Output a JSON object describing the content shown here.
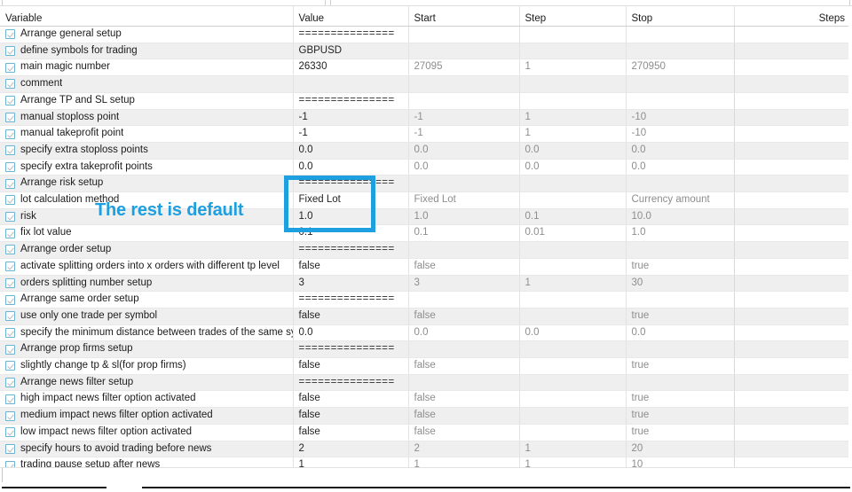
{
  "window": {
    "tabs": [
      {
        "label": ""
      },
      {
        "label": ""
      }
    ]
  },
  "table": {
    "headers": {
      "variable": "Variable",
      "value": "Value",
      "start": "Start",
      "step": "Step",
      "stop": "Stop",
      "steps": "Steps"
    },
    "rows": [
      {
        "checked": true,
        "variable": "Arrange general setup",
        "value": "===============",
        "start": "",
        "step": "",
        "stop": "",
        "steps": ""
      },
      {
        "checked": true,
        "variable": "define symbols for trading",
        "value": "GBPUSD",
        "start": "",
        "step": "",
        "stop": "",
        "steps": ""
      },
      {
        "checked": true,
        "variable": "main magic number",
        "value": "26330",
        "start": "27095",
        "step": "1",
        "stop": "270950",
        "steps": ""
      },
      {
        "checked": true,
        "variable": "comment",
        "value": "",
        "start": "",
        "step": "",
        "stop": "",
        "steps": ""
      },
      {
        "checked": true,
        "variable": "Arrange TP and SL setup",
        "value": "===============",
        "start": "",
        "step": "",
        "stop": "",
        "steps": ""
      },
      {
        "checked": true,
        "variable": "manual stoploss point",
        "value": "-1",
        "start": "-1",
        "step": "1",
        "stop": "-10",
        "steps": ""
      },
      {
        "checked": true,
        "variable": "manual takeprofit point",
        "value": "-1",
        "start": "-1",
        "step": "1",
        "stop": "-10",
        "steps": ""
      },
      {
        "checked": true,
        "variable": "specify extra stoploss points",
        "value": "0.0",
        "start": "0.0",
        "step": "0.0",
        "stop": "0.0",
        "steps": ""
      },
      {
        "checked": true,
        "variable": "specify extra takeprofit points",
        "value": "0.0",
        "start": "0.0",
        "step": "0.0",
        "stop": "0.0",
        "steps": ""
      },
      {
        "checked": true,
        "variable": "Arrange risk setup",
        "value": "===============",
        "start": "",
        "step": "",
        "stop": "",
        "steps": ""
      },
      {
        "checked": true,
        "variable": "lot calculation method",
        "value": "Fixed Lot",
        "start": "Fixed Lot",
        "step": "",
        "stop": "Currency amount",
        "steps": ""
      },
      {
        "checked": true,
        "variable": "risk",
        "value": "1.0",
        "start": "1.0",
        "step": "0.1",
        "stop": "10.0",
        "steps": ""
      },
      {
        "checked": true,
        "variable": "fix lot value",
        "value": "0.1",
        "start": "0.1",
        "step": "0.01",
        "stop": "1.0",
        "steps": ""
      },
      {
        "checked": true,
        "variable": "Arrange order setup",
        "value": "===============",
        "start": "",
        "step": "",
        "stop": "",
        "steps": ""
      },
      {
        "checked": true,
        "variable": "activate splitting orders into x orders with different tp level",
        "value": "false",
        "start": "false",
        "step": "",
        "stop": "true",
        "steps": ""
      },
      {
        "checked": true,
        "variable": "orders splitting number setup",
        "value": "3",
        "start": "3",
        "step": "1",
        "stop": "30",
        "steps": ""
      },
      {
        "checked": true,
        "variable": "Arrange same order setup",
        "value": "===============",
        "start": "",
        "step": "",
        "stop": "",
        "steps": ""
      },
      {
        "checked": true,
        "variable": "use only one trade per symbol",
        "value": "false",
        "start": "false",
        "step": "",
        "stop": "true",
        "steps": ""
      },
      {
        "checked": true,
        "variable": "specify the minimum distance between trades of the same sym...",
        "value": "0.0",
        "start": "0.0",
        "step": "0.0",
        "stop": "0.0",
        "steps": ""
      },
      {
        "checked": true,
        "variable": "Arrange prop firms setup",
        "value": "===============",
        "start": "",
        "step": "",
        "stop": "",
        "steps": ""
      },
      {
        "checked": true,
        "variable": "slightly change tp & sl(for prop firms)",
        "value": "false",
        "start": "false",
        "step": "",
        "stop": "true",
        "steps": ""
      },
      {
        "checked": true,
        "variable": "Arrange news filter setup",
        "value": "===============",
        "start": "",
        "step": "",
        "stop": "",
        "steps": ""
      },
      {
        "checked": true,
        "variable": "high impact news filter option activated",
        "value": "false",
        "start": "false",
        "step": "",
        "stop": "true",
        "steps": ""
      },
      {
        "checked": true,
        "variable": "medium impact news filter option activated",
        "value": "false",
        "start": "false",
        "step": "",
        "stop": "true",
        "steps": ""
      },
      {
        "checked": true,
        "variable": "low impact news filter option activated",
        "value": "false",
        "start": "false",
        "step": "",
        "stop": "true",
        "steps": ""
      },
      {
        "checked": true,
        "variable": "specify hours to avoid trading before news",
        "value": "2",
        "start": "2",
        "step": "1",
        "stop": "20",
        "steps": ""
      },
      {
        "checked": true,
        "variable": "trading pause setup after news",
        "value": "1",
        "start": "1",
        "step": "1",
        "stop": "10",
        "steps": ""
      }
    ]
  },
  "annotation": {
    "text": "The rest is default",
    "color": "#1e9fe0",
    "highlight_rows": [
      "lot calculation method",
      "risk",
      "fix lot value"
    ]
  }
}
